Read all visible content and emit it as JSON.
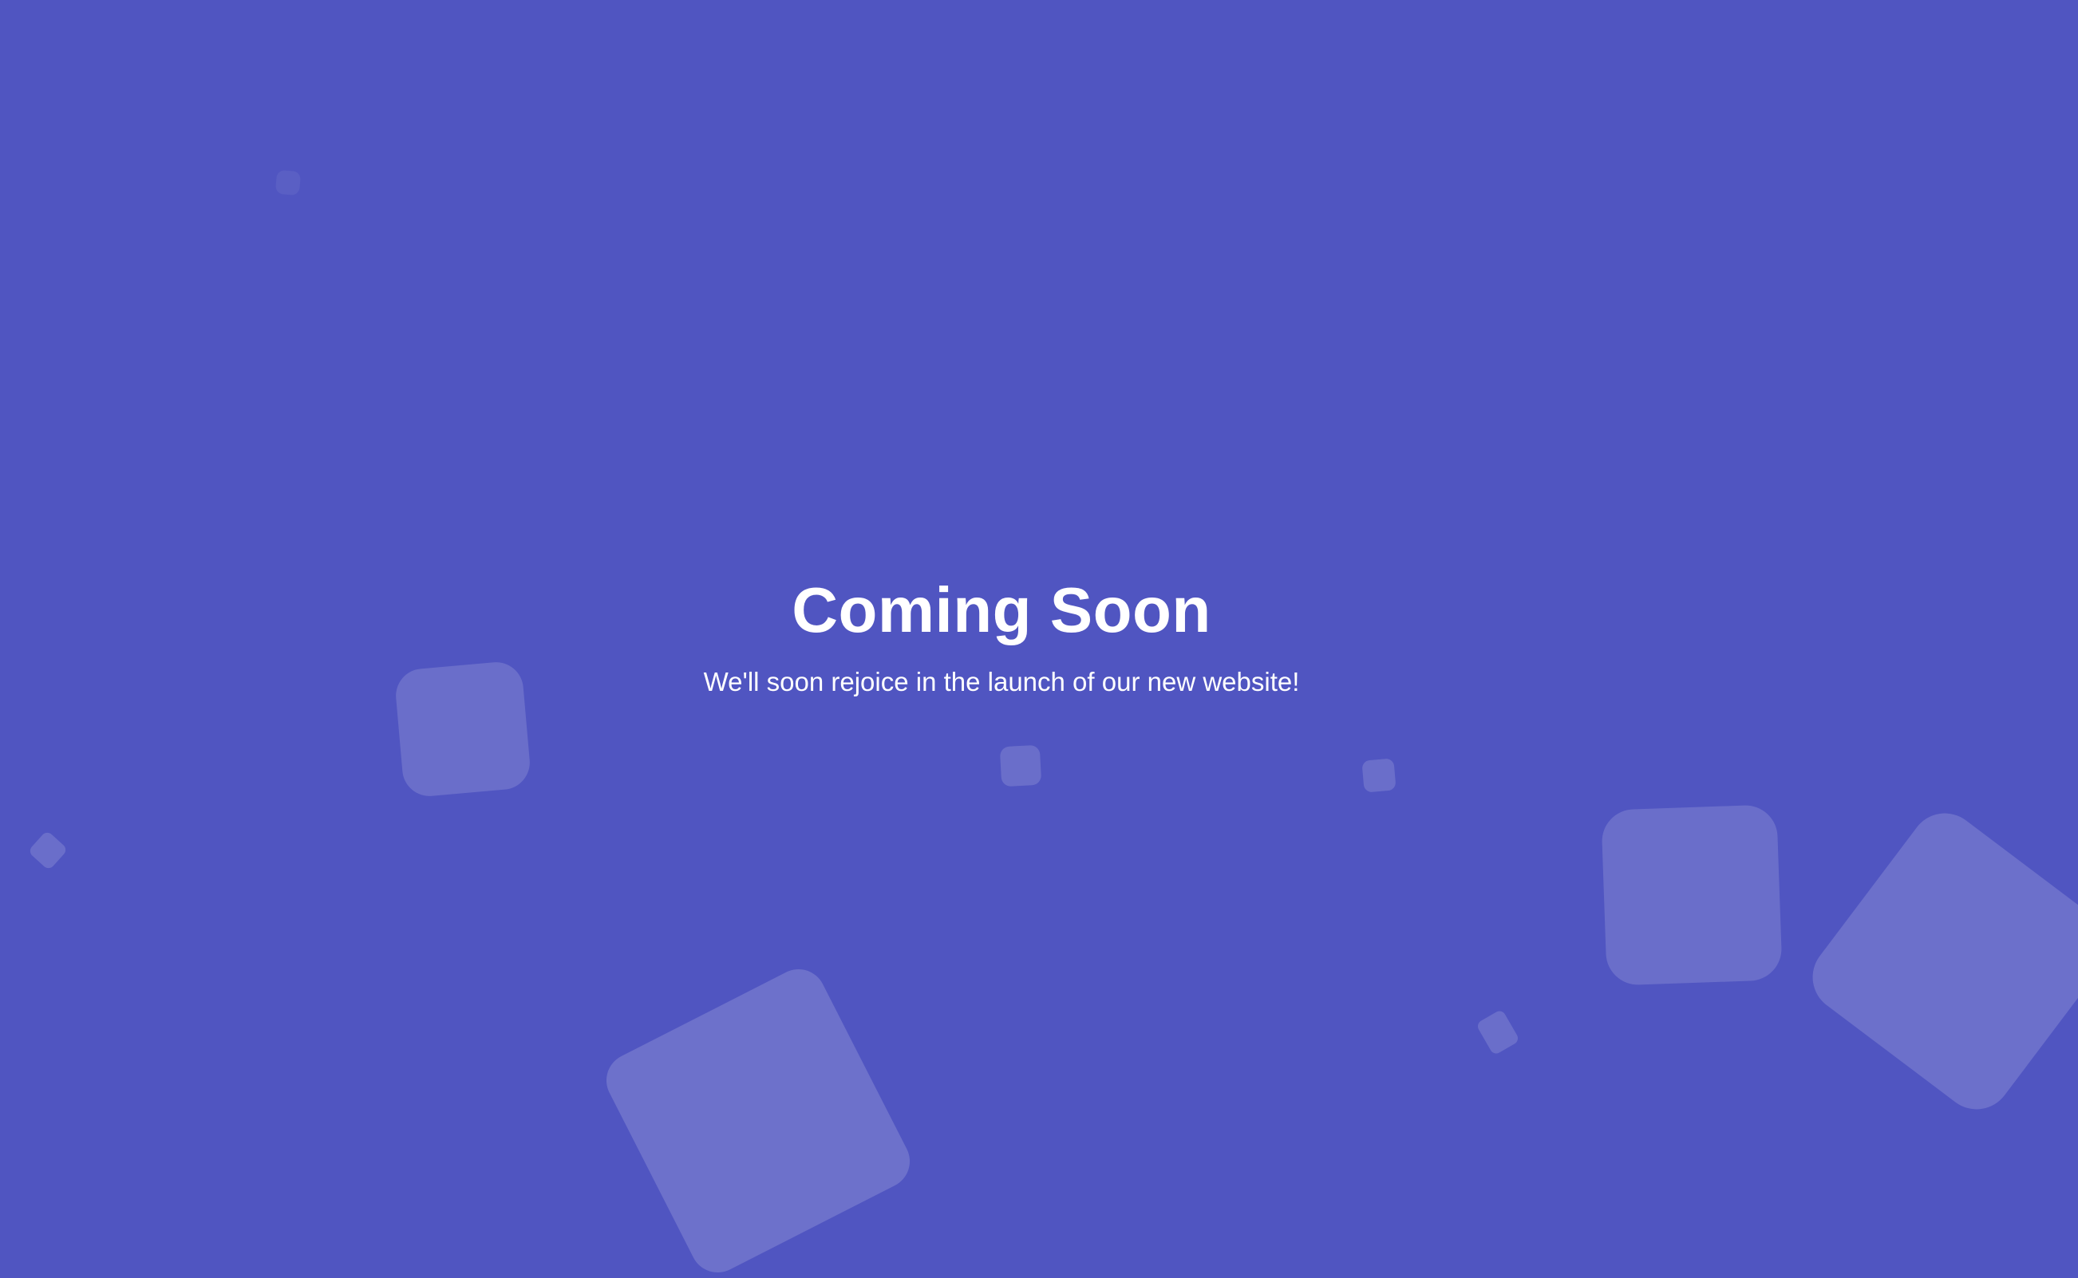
{
  "page": {
    "title": "Coming Soon",
    "subtitle": "We'll soon rejoice in the launch of our new website!"
  },
  "colors": {
    "background": "#5055c1",
    "text": "#ffffff",
    "shape_fill": "rgba(255,255,255,0.15)"
  },
  "decorations": {
    "shape": "rounded-square",
    "count": 11
  }
}
